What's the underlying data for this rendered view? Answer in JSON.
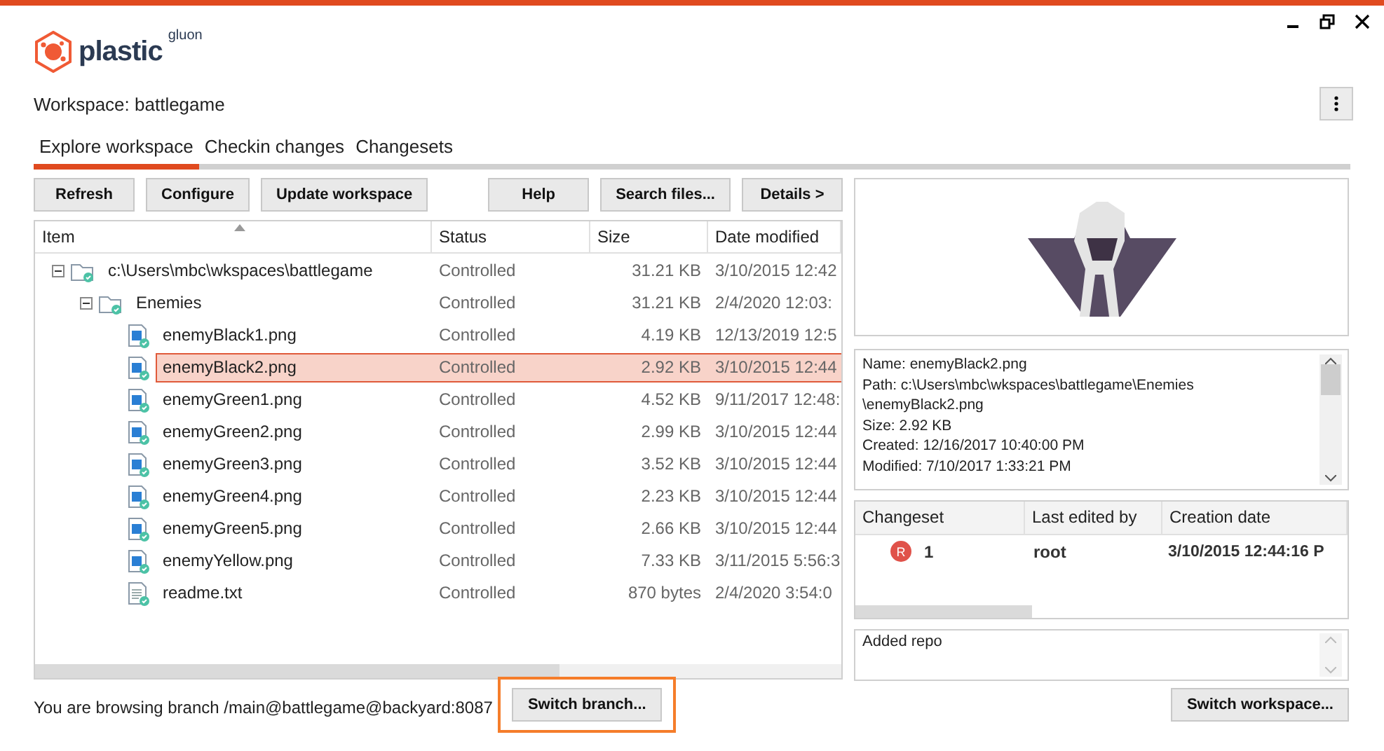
{
  "app": {
    "logo_text": "plastic",
    "logo_suffix": "gluon"
  },
  "workspace": {
    "label": "Workspace: battlegame"
  },
  "tabs": [
    {
      "label": "Explore workspace",
      "selected": true
    },
    {
      "label": "Checkin changes",
      "selected": false
    },
    {
      "label": "Changesets",
      "selected": false
    }
  ],
  "toolbar": {
    "left": [
      "Refresh",
      "Configure",
      "Update workspace"
    ],
    "right": [
      "Help",
      "Search files...",
      "Details >"
    ]
  },
  "table": {
    "columns": [
      "Item",
      "Status",
      "Size",
      "Date modified"
    ],
    "rows": [
      {
        "kind": "folder",
        "name": "c:\\Users\\mbc\\wkspaces\\battlegame",
        "status": "Controlled",
        "size": "31.21 KB",
        "date": "3/10/2015 12:42",
        "selected": false,
        "expanded": true,
        "children": [
          {
            "kind": "folder",
            "name": "Enemies",
            "status": "Controlled",
            "size": "31.21 KB",
            "date": "2/4/2020 12:03:",
            "selected": false,
            "expanded": true,
            "children": [
              {
                "kind": "image",
                "name": "enemyBlack1.png",
                "status": "Controlled",
                "size": "4.19 KB",
                "date": "12/13/2019 12:5",
                "selected": false
              },
              {
                "kind": "image",
                "name": "enemyBlack2.png",
                "status": "Controlled",
                "size": "2.92 KB",
                "date": "3/10/2015 12:44",
                "selected": true
              },
              {
                "kind": "image",
                "name": "enemyGreen1.png",
                "status": "Controlled",
                "size": "4.52 KB",
                "date": "9/11/2017 12:48:",
                "selected": false
              },
              {
                "kind": "image",
                "name": "enemyGreen2.png",
                "status": "Controlled",
                "size": "2.99 KB",
                "date": "3/10/2015 12:44",
                "selected": false
              },
              {
                "kind": "image",
                "name": "enemyGreen3.png",
                "status": "Controlled",
                "size": "3.52 KB",
                "date": "3/10/2015 12:44",
                "selected": false
              },
              {
                "kind": "image",
                "name": "enemyGreen4.png",
                "status": "Controlled",
                "size": "2.23 KB",
                "date": "3/10/2015 12:44",
                "selected": false
              },
              {
                "kind": "image",
                "name": "enemyGreen5.png",
                "status": "Controlled",
                "size": "2.66 KB",
                "date": "3/10/2015 12:44",
                "selected": false
              },
              {
                "kind": "image",
                "name": "enemyYellow.png",
                "status": "Controlled",
                "size": "7.33 KB",
                "date": "3/11/2015 5:56:3",
                "selected": false
              },
              {
                "kind": "text",
                "name": "readme.txt",
                "status": "Controlled",
                "size": "870 bytes",
                "date": "2/4/2020 3:54:0",
                "selected": false
              }
            ]
          }
        ]
      }
    ]
  },
  "status": {
    "branch_text": "You are browsing branch /main@battlegame@backyard:8087",
    "switch_branch": "Switch branch...",
    "highlighted": true
  },
  "details": {
    "info_lines": [
      "Name: enemyBlack2.png",
      "Path: c:\\Users\\mbc\\wkspaces\\battlegame\\Enemies",
      "\\enemyBlack2.png",
      "Size: 2.92 KB",
      "Created: 12/16/2017 10:40:00 PM",
      "Modified: 7/10/2017 1:33:21 PM"
    ],
    "changesets": {
      "columns": [
        "Changeset",
        "Last edited by",
        "Creation date"
      ],
      "rows": [
        {
          "badge": "R",
          "changeset": "1",
          "author": "root",
          "date": "3/10/2015 12:44:16 P"
        }
      ]
    },
    "comment": "Added repo",
    "switch_workspace": "Switch workspace..."
  }
}
